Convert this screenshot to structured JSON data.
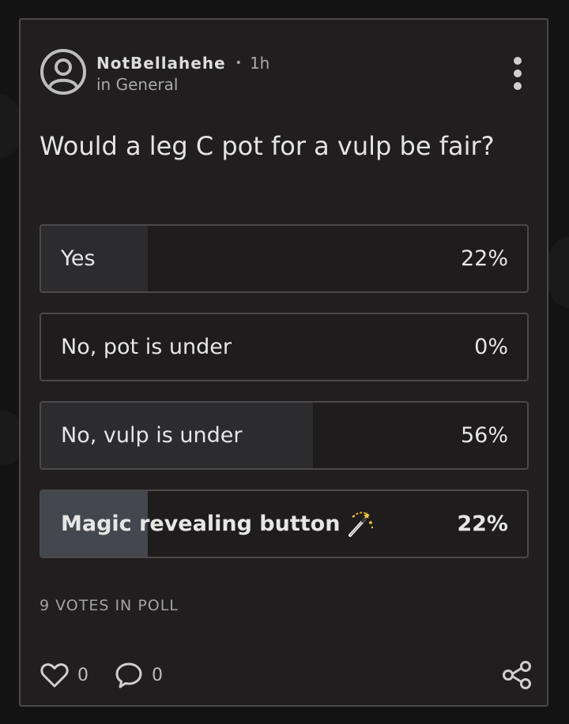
{
  "post": {
    "author": "NotBellahehe",
    "time": "1h",
    "community": "in General",
    "question": "Would a leg C pot for a vulp be fair?"
  },
  "poll": {
    "options": [
      {
        "label": "Yes",
        "percent_text": "22%",
        "percent": 22,
        "selected": false
      },
      {
        "label": "No, pot is under",
        "percent_text": "0%",
        "percent": 0,
        "selected": false
      },
      {
        "label": "No, vulp is under",
        "percent_text": "56%",
        "percent": 56,
        "selected": false
      },
      {
        "label": "Magic revealing button",
        "percent_text": "22%",
        "percent": 22,
        "selected": true,
        "icon": "magic-wand-icon"
      }
    ],
    "votes_text": "9 VOTES IN POLL"
  },
  "actions": {
    "likes": "0",
    "comments": "0"
  },
  "icons": {
    "avatar": "user-circle-icon",
    "menu": "kebab-menu-icon",
    "like": "heart-icon",
    "comment": "speech-bubble-icon",
    "share": "share-icon"
  },
  "colors": {
    "background": "#141313",
    "card": "#201e1e",
    "border": "#4a4747",
    "bar_fill": "#2c2c2f",
    "bar_fill_selected": "#45474f",
    "text": "#e4e4e4",
    "muted_text": "#a9a9a9"
  }
}
